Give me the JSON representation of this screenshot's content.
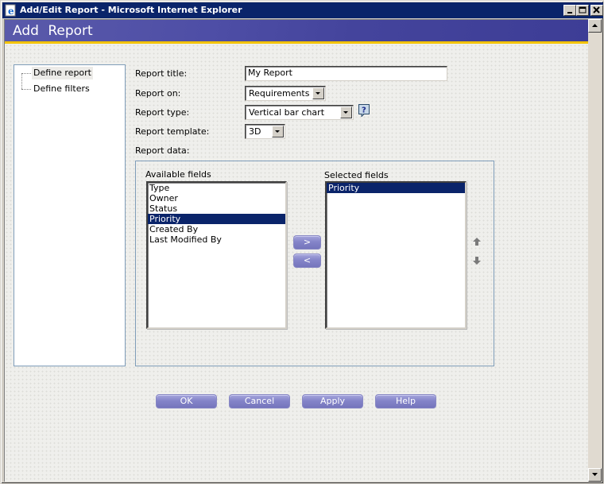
{
  "window": {
    "title": "Add/Edit Report - Microsoft Internet Explorer",
    "icon": "ie-icon",
    "controls": [
      "minimize",
      "maximize",
      "close"
    ]
  },
  "header": {
    "title": "Add Report",
    "accent_color": "#f3c300",
    "background_color": "#4a4aa2"
  },
  "tree": {
    "items": [
      {
        "label": "Define report",
        "selected": true
      },
      {
        "label": "Define filters",
        "selected": false
      }
    ]
  },
  "form": {
    "report_title": {
      "label": "Report title:",
      "value": "My Report"
    },
    "report_on": {
      "label": "Report on:",
      "value": "Requirements"
    },
    "report_type": {
      "label": "Report type:",
      "value": "Vertical bar chart",
      "help_icon": "help-icon"
    },
    "report_template": {
      "label": "Report template:",
      "value": "3D"
    },
    "report_data": {
      "label": "Report data:"
    }
  },
  "fields": {
    "available_label": "Available fields",
    "selected_label": "Selected fields",
    "available": [
      {
        "label": "Type",
        "selected": false
      },
      {
        "label": "Owner",
        "selected": false
      },
      {
        "label": "Status",
        "selected": false
      },
      {
        "label": "Priority",
        "selected": true
      },
      {
        "label": "Created By",
        "selected": false
      },
      {
        "label": "Last Modified By",
        "selected": false
      }
    ],
    "selected": [
      {
        "label": "Priority",
        "selected": true
      }
    ],
    "add_label": ">",
    "remove_label": "<",
    "move_up_icon": "arrow-up-icon",
    "move_down_icon": "arrow-down-icon"
  },
  "buttons": {
    "ok": "OK",
    "cancel": "Cancel",
    "apply": "Apply",
    "help": "Help"
  },
  "colors": {
    "selection": "#0a246a",
    "button": "#8585c9",
    "titlebar": "#0a246a"
  }
}
